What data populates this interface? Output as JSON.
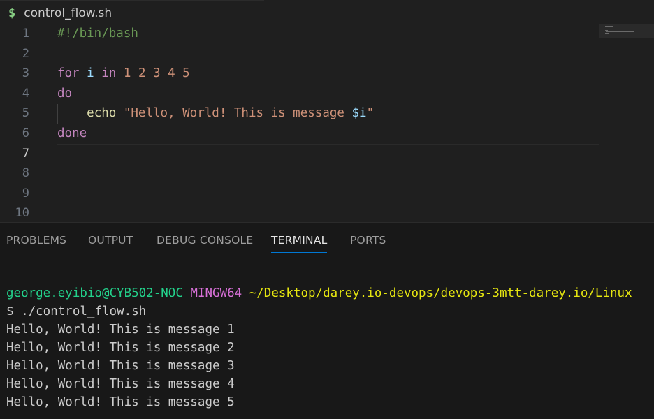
{
  "editor": {
    "tab": {
      "icon": "$",
      "label": "control_flow.sh"
    },
    "line_numbers": [
      "1",
      "2",
      "3",
      "4",
      "5",
      "6",
      "7",
      "8",
      "9",
      "10"
    ],
    "code": {
      "line1": {
        "shebang": "#!/bin/bash"
      },
      "line3": {
        "for": "for",
        "var": "i",
        "in": "in",
        "list": "1 2 3 4 5"
      },
      "line4": {
        "do": "do"
      },
      "line5": {
        "indent": "    ",
        "echo": "echo",
        "str_open": "\"Hello, World! This is message ",
        "var": "$i",
        "str_close": "\""
      },
      "line6": {
        "done": "done"
      }
    }
  },
  "panel": {
    "tabs": [
      "PROBLEMS",
      "OUTPUT",
      "DEBUG CONSOLE",
      "TERMINAL",
      "PORTS"
    ],
    "active_tab": "TERMINAL"
  },
  "terminal": {
    "prompt_user": "george.eyibio@CYB502-NOC",
    "prompt_system": "MINGW64",
    "prompt_path": "~/Desktop/darey.io-devops/devops-3mtt-darey.io/Linux",
    "command": "$ ./control_flow.sh",
    "output": [
      "Hello, World! This is message 1",
      "Hello, World! This is message 2",
      "Hello, World! This is message 3",
      "Hello, World! This is message 4",
      "Hello, World! This is message 5"
    ]
  },
  "colors": {
    "editor_bg": "#1f1f1f",
    "panel_bg": "#181818",
    "keyword": "#c586c0",
    "string": "#ce9178",
    "comment": "#6a9955",
    "variable": "#9cdcfe",
    "command": "#dcdcaa",
    "terminal_user": "#23d18b",
    "terminal_system": "#d670d6",
    "terminal_path": "#e5e510",
    "accent": "#0078d4"
  }
}
